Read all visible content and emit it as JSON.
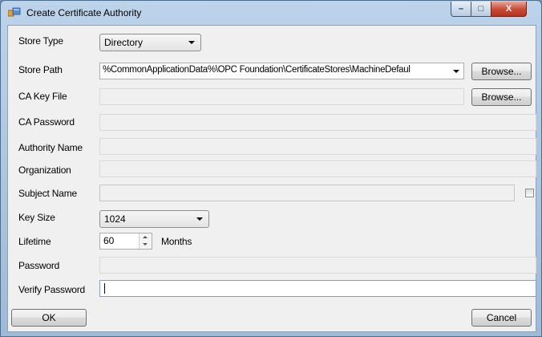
{
  "window": {
    "title": "Create Certificate Authority",
    "icons": {
      "app": "certificate-app-icon",
      "minimize": "minimize-icon",
      "maximize": "maximize-icon",
      "close": "close-icon"
    },
    "minimize_glyph": "–",
    "maximize_glyph": "□",
    "close_glyph": "X"
  },
  "form": {
    "store_type": {
      "label": "Store Type",
      "value": "Directory"
    },
    "store_path": {
      "label": "Store Path",
      "value": "%CommonApplicationData%\\OPC Foundation\\CertificateStores\\MachineDefaul",
      "browse": "Browse..."
    },
    "ca_key_file": {
      "label": "CA Key File",
      "value": "",
      "browse": "Browse..."
    },
    "ca_password": {
      "label": "CA Password",
      "value": ""
    },
    "authority_name": {
      "label": "Authority Name",
      "value": ""
    },
    "organization": {
      "label": "Organization",
      "value": ""
    },
    "subject_name": {
      "label": "Subject Name",
      "value": "",
      "checkbox_checked": false
    },
    "key_size": {
      "label": "Key Size",
      "value": "1024"
    },
    "lifetime": {
      "label": "Lifetime",
      "value": "60",
      "unit": "Months"
    },
    "password": {
      "label": "Password",
      "value": ""
    },
    "verify_password": {
      "label": "Verify Password",
      "value": ""
    }
  },
  "buttons": {
    "ok": "OK",
    "cancel": "Cancel"
  }
}
